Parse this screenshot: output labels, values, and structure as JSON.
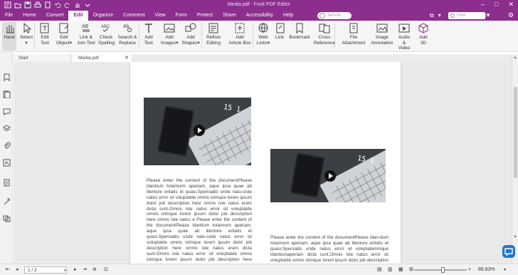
{
  "window": {
    "title": "Media.pdf - Foxit PDF Editor"
  },
  "menu": {
    "items": [
      "File",
      "Home",
      "Convert",
      "Edit",
      "Organize",
      "Comment",
      "View",
      "Form",
      "Protect",
      "Share",
      "Accessibility",
      "Help"
    ],
    "active": "Edit",
    "tell_me_placeholder": "Tell me...",
    "find_placeholder": "Find"
  },
  "ribbon": {
    "tools": [
      {
        "line1": "Hand",
        "line2": "",
        "icon": "hand-icon"
      },
      {
        "line1": "Select",
        "line2": "▾",
        "icon": "select-cursor-icon"
      },
      {
        "line1": "Edit",
        "line2": "Text",
        "icon": "edit-text-icon"
      },
      {
        "line1": "Edit",
        "line2": "Object▾",
        "icon": "edit-object-icon"
      },
      {
        "line1": "Link &",
        "line2": "Join Text",
        "icon": "link-join-text-icon"
      },
      {
        "line1": "Check",
        "line2": "Spelling",
        "icon": "check-spelling-icon"
      },
      {
        "line1": "Search &",
        "line2": "Replace",
        "icon": "search-replace-icon"
      },
      {
        "line1": "Add",
        "line2": "Text",
        "icon": "add-text-icon"
      },
      {
        "line1": "Add",
        "line2": "Images▾",
        "icon": "add-image-icon"
      },
      {
        "line1": "Add",
        "line2": "Shapes▾",
        "icon": "add-shapes-icon"
      },
      {
        "line1": "Reflow",
        "line2": "Editing",
        "icon": "reflow-icon"
      },
      {
        "line1": "Add",
        "line2": "Article Box",
        "icon": "article-box-icon"
      },
      {
        "line1": "Web",
        "line2": "Links▾",
        "icon": "web-link-icon"
      },
      {
        "line1": "Link",
        "line2": "",
        "icon": "link-icon"
      },
      {
        "line1": "Bookmark",
        "line2": "",
        "icon": "bookmark-icon"
      },
      {
        "line1": "Cross",
        "line2": "Reference",
        "icon": "cross-reference-icon"
      },
      {
        "line1": "File",
        "line2": "Attachment",
        "icon": "file-attachment-icon"
      },
      {
        "line1": "Image",
        "line2": "Annotation",
        "icon": "image-annotation-icon"
      },
      {
        "line1": "Audio",
        "line2": "& Video",
        "icon": "audio-video-icon"
      },
      {
        "line1": "Add",
        "line2": "3D",
        "icon": "add-3d-icon"
      }
    ]
  },
  "tabs": [
    {
      "label": "Start",
      "closable": false
    },
    {
      "label": "Media.pdf",
      "closable": true
    }
  ],
  "document": {
    "video1_digits": "15 1",
    "video2_digits": "15 1",
    "text1": "Please enter the content of the documentPlease ldantium totamrem aperiam, aque ipsa quae ab illentore eritatis et quasi.Sperisiatis unde natu-siste natus error sit voluptatde omnis istmque lorem ipsum dolor job description here omnis iste natus eram dicta sunt.Omnis iste natus error sit voluptatde omnis istmque lorem ipsum dolor job description here omnis iste natus e Please enter the content of the documentPlease ldantium totamrem aperiam, aque ipsa quae ab illentore eritatis et quasi.Sperisiatis unde natu-siste natus error sit voluptatde omnis istmque lorem ipsum dolor job description here omnis iste natus eram dicta sunt.Omnis iste natus error sit voluptatde omnis istmque lorem ipsum dolor job description here omnis iste natus",
    "text2": "Please enter the content of the documentPlease ldan-tium totamrem aperiam, aque ipsa quae ab illentore eritatis et quasi.Spersiatis unde natus error et volvptatemmque ldantiumaperiam dicta sunt.Omnis iste natus error sit voluptatde omnis istmque lorem ipsum dolor job description here omnis iste natus"
  },
  "status": {
    "page_value": "1 / 2",
    "zoom": "89.83%",
    "zoom_minus": "−",
    "zoom_plus": "+"
  },
  "colors": {
    "accent": "#8b2e8d",
    "chat": "#1f77d0"
  }
}
